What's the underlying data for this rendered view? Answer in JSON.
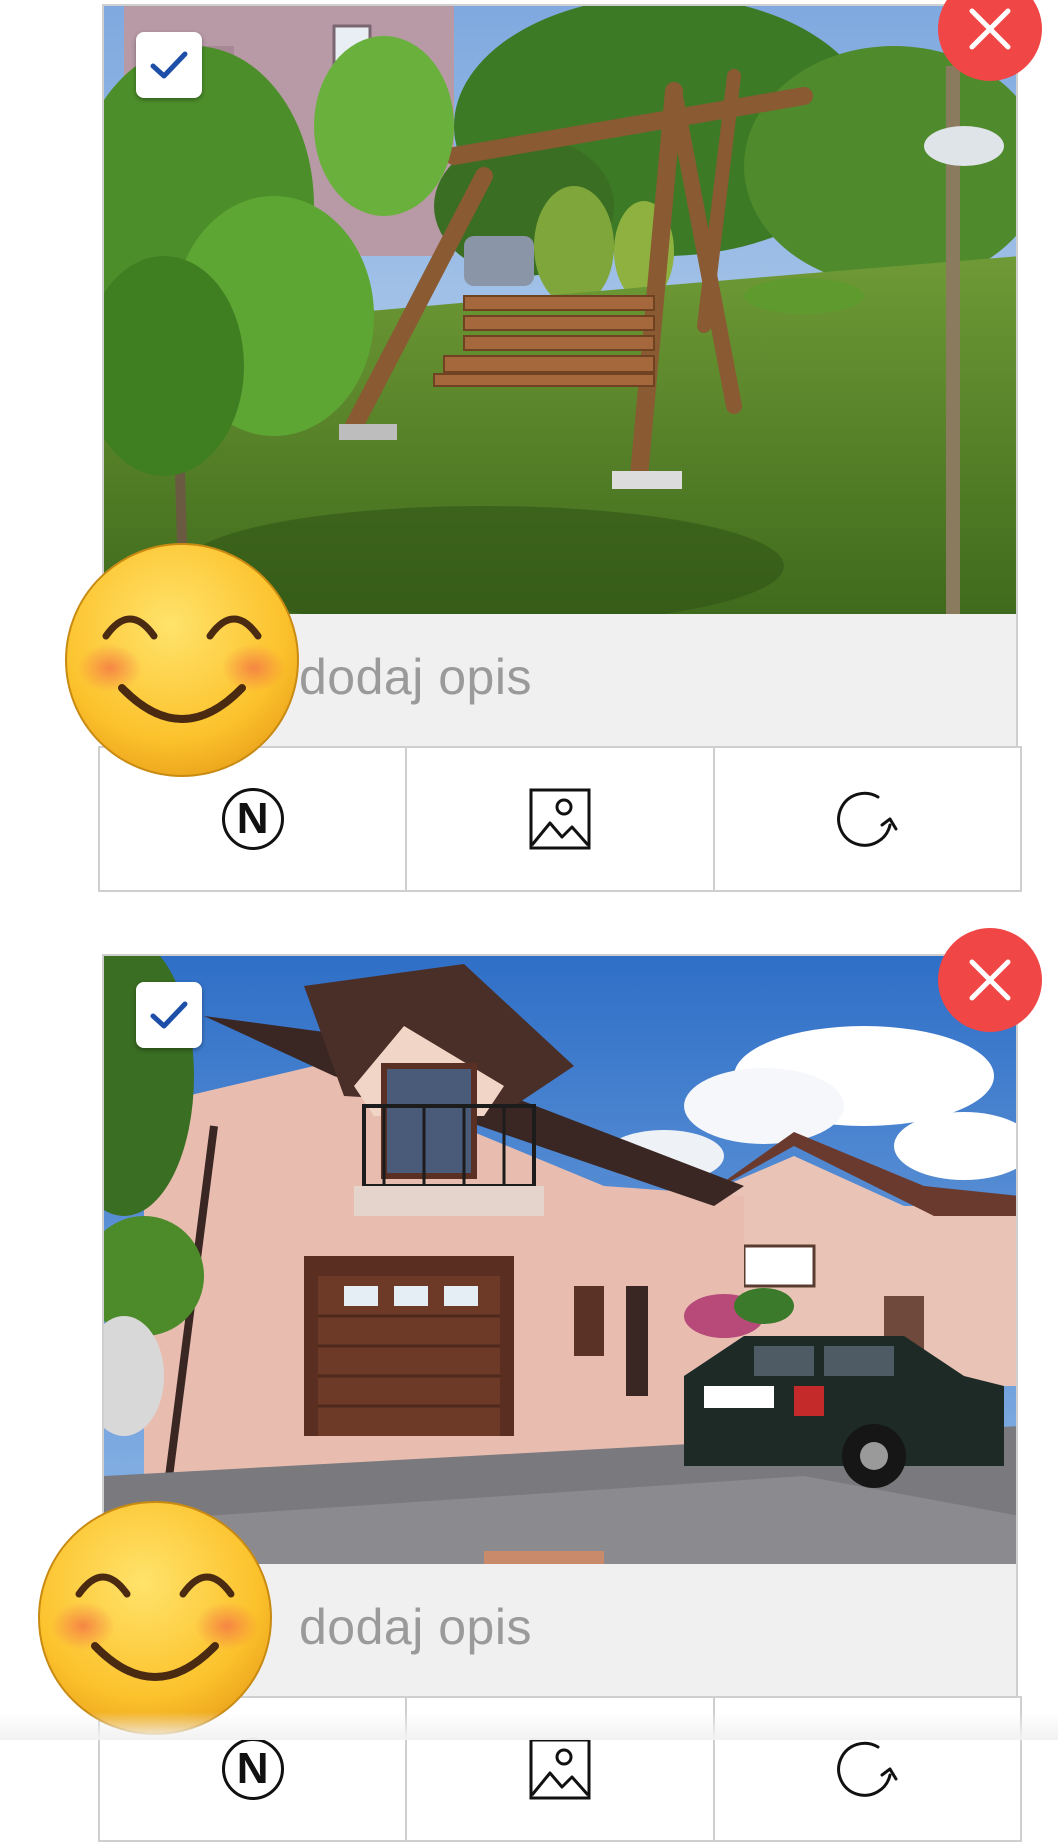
{
  "photos": [
    {
      "scene": "garden-swing",
      "selected": true,
      "description_placeholder": "dodaj opis",
      "actions": {
        "badge_letter": "N",
        "image_icon": "image-icon",
        "rotate_icon": "rotate-icon"
      }
    },
    {
      "scene": "house-exterior",
      "selected": true,
      "description_placeholder": "dodaj opis",
      "actions": {
        "badge_letter": "N",
        "image_icon": "image-icon",
        "rotate_icon": "rotate-icon"
      }
    }
  ],
  "colors": {
    "remove_button": "#f04646",
    "check_color": "#1e4fa8",
    "border": "#cfcfcf",
    "description_bg": "#f0f0f0",
    "placeholder_text": "#9a9a9a"
  }
}
